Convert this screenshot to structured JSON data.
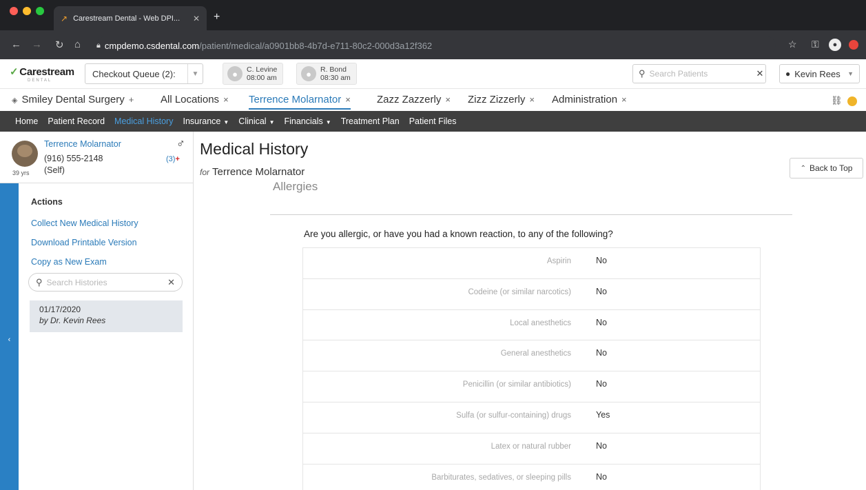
{
  "browser": {
    "tab_title": "Carestream Dental - Web DPI...",
    "url_host": "cmpdemo.csdental.com",
    "url_path": "/patient/medical/a0901bb8-4b7d-e711-80c2-000d3a12f362"
  },
  "header": {
    "logo": "Carestream",
    "logo_sub": "DENTAL",
    "queue_label": "Checkout Queue (2):",
    "appointments": [
      {
        "name": "C. Levine",
        "time": "08:00 am"
      },
      {
        "name": "R. Bond",
        "time": "08:30 am"
      }
    ],
    "search_placeholder": "Search Patients",
    "user": "Kevin Rees"
  },
  "context_tabs": [
    {
      "label": "Smiley Dental Surgery",
      "mark": "+"
    },
    {
      "label": "All Locations",
      "mark": "×"
    },
    {
      "label": "Terrence Molarnator",
      "mark": "×"
    },
    {
      "label": "Zazz Zazzerly",
      "mark": "×"
    },
    {
      "label": "Zizz Zizzerly",
      "mark": "×"
    },
    {
      "label": "Administration",
      "mark": "×"
    }
  ],
  "main_nav": {
    "home": "Home",
    "patient_record": "Patient Record",
    "medical_history": "Medical History",
    "insurance": "Insurance",
    "clinical": "Clinical",
    "financials": "Financials",
    "treatment_plan": "Treatment Plan",
    "patient_files": "Patient Files"
  },
  "patient": {
    "name": "Terrence Molarnator",
    "phone": "(916) 555-2148",
    "relation": "(Self)",
    "age": "39 yrs",
    "alert_count": "(3)",
    "alert_mark": "+"
  },
  "sidebar": {
    "actions_heading": "Actions",
    "links": {
      "collect": "Collect New Medical History",
      "download": "Download Printable Version",
      "copy": "Copy as New Exam"
    },
    "search_placeholder": "Search Histories",
    "history": {
      "date": "01/17/2020",
      "by": "by Dr. Kevin Rees"
    }
  },
  "main": {
    "title": "Medical History",
    "for_label": "for",
    "for_name": "Terrence Molarnator",
    "back_to_top": "Back to Top",
    "section": "Allergies",
    "question": "Are you allergic, or have you had a known reaction, to any of the following?",
    "rows": [
      {
        "q": "Aspirin",
        "a": "No"
      },
      {
        "q": "Codeine (or similar narcotics)",
        "a": "No"
      },
      {
        "q": "Local anesthetics",
        "a": "No"
      },
      {
        "q": "General anesthetics",
        "a": "No"
      },
      {
        "q": "Penicillin (or similar antibiotics)",
        "a": "No"
      },
      {
        "q": "Sulfa (or sulfur-containing) drugs",
        "a": "Yes"
      },
      {
        "q": "Latex or natural rubber",
        "a": "No"
      },
      {
        "q": "Barbiturates, sedatives, or sleeping pills",
        "a": "No"
      }
    ]
  }
}
